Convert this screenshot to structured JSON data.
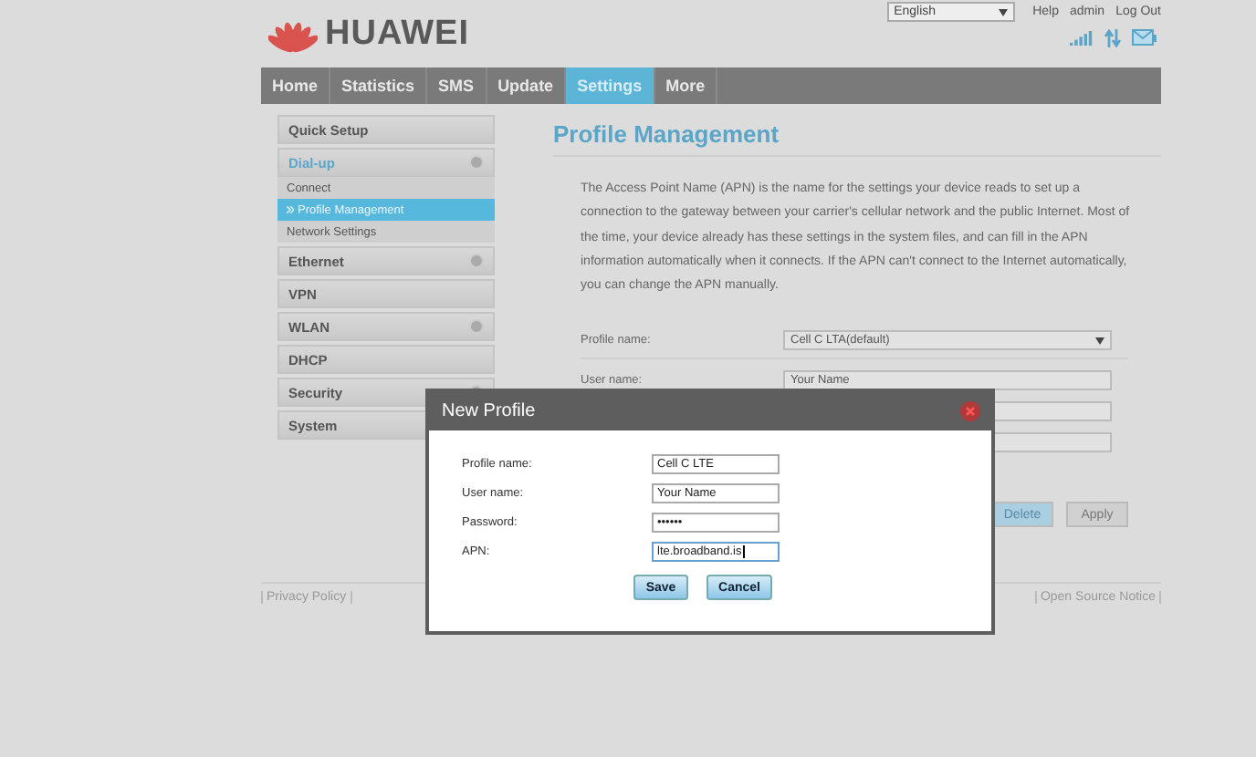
{
  "brand": {
    "name": "HUAWEI"
  },
  "top_bar": {
    "language": "English",
    "links": [
      "Help",
      "admin",
      "Log Out"
    ]
  },
  "nav": {
    "tabs": [
      {
        "label": "Home",
        "selected": false
      },
      {
        "label": "Statistics",
        "selected": false
      },
      {
        "label": "SMS",
        "selected": false
      },
      {
        "label": "Update",
        "selected": false
      },
      {
        "label": "Settings",
        "selected": true
      },
      {
        "label": "More",
        "selected": false
      }
    ]
  },
  "sidebar": {
    "items": [
      {
        "label": "Quick Setup",
        "kind": "single"
      },
      {
        "label": "Dial-up",
        "kind": "group",
        "expanded": true,
        "children": [
          {
            "label": "Connect",
            "selected": false
          },
          {
            "label": "Profile Management",
            "selected": true
          },
          {
            "label": "Network Settings",
            "selected": false
          }
        ]
      },
      {
        "label": "Ethernet",
        "kind": "group",
        "expanded": false
      },
      {
        "label": "VPN",
        "kind": "single"
      },
      {
        "label": "WLAN",
        "kind": "group",
        "expanded": false
      },
      {
        "label": "DHCP",
        "kind": "single"
      },
      {
        "label": "Security",
        "kind": "group",
        "expanded": false
      },
      {
        "label": "System",
        "kind": "single"
      }
    ]
  },
  "main": {
    "title": "Profile Management",
    "description": "The Access Point Name (APN) is the name for the settings your device reads to set up a connection to the gateway between your carrier's cellular network and the public Internet. Most of the time, your device already has these settings in the system files, and can fill in the APN information automatically when it connects. If the APN can't connect to the Internet automatically, you can change the APN manually.",
    "form": {
      "rows": [
        {
          "kind": "select",
          "label": "Profile name:",
          "value": "Cell C LTA(default)"
        },
        {
          "kind": "text",
          "label": "User name:",
          "value": "Your Name"
        },
        {
          "kind": "text"
        },
        {
          "kind": "text"
        }
      ]
    },
    "buttons": [
      {
        "label": "Delete",
        "kind": "primary"
      },
      {
        "label": "Apply",
        "kind": "secondary"
      }
    ]
  },
  "footer": {
    "links": [
      "Privacy Policy",
      "Open Source Notice"
    ]
  },
  "dialog": {
    "title": "New Profile",
    "fields": [
      {
        "label": "Profile name:",
        "value": "Cell C LTE",
        "focused": false
      },
      {
        "label": "User name:",
        "value": "Your Name",
        "focused": false
      },
      {
        "label": "Password:",
        "value": "••••••",
        "focused": false
      },
      {
        "label": "APN:",
        "value": "lte.broadband.is",
        "focused": true
      }
    ],
    "buttons": [
      "Save",
      "Cancel"
    ]
  }
}
